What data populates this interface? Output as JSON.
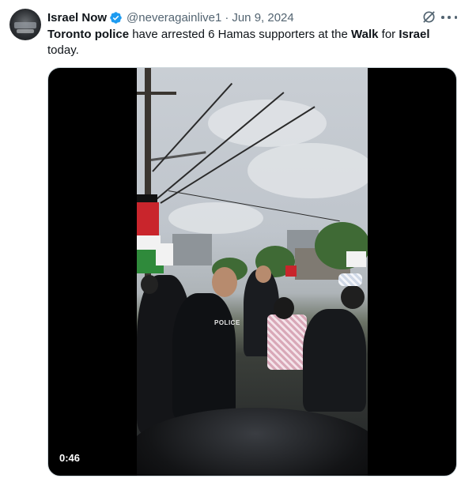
{
  "tweet": {
    "author_name": "Israel Now",
    "handle": "@neveragainlive1",
    "separator": "·",
    "date": "Jun 9, 2024",
    "text_parts": [
      {
        "bold": true,
        "text": "Toronto police"
      },
      {
        "bold": false,
        "text": " have arrested 6 Hamas supporters at the "
      },
      {
        "bold": true,
        "text": "Walk"
      },
      {
        "bold": false,
        "text": " for "
      },
      {
        "bold": true,
        "text": "Israel"
      },
      {
        "bold": false,
        "text": " today."
      }
    ]
  },
  "media": {
    "type": "video",
    "duration": "0:46",
    "overlay_text": "POLICE"
  },
  "icons": {
    "verified": "verified-badge-icon",
    "grok": "grok-icon",
    "more": "more-options-icon"
  },
  "colors": {
    "verified": "#1d9bf0",
    "text": "#0f1419",
    "secondary": "#536471",
    "border": "#cfd9de"
  }
}
